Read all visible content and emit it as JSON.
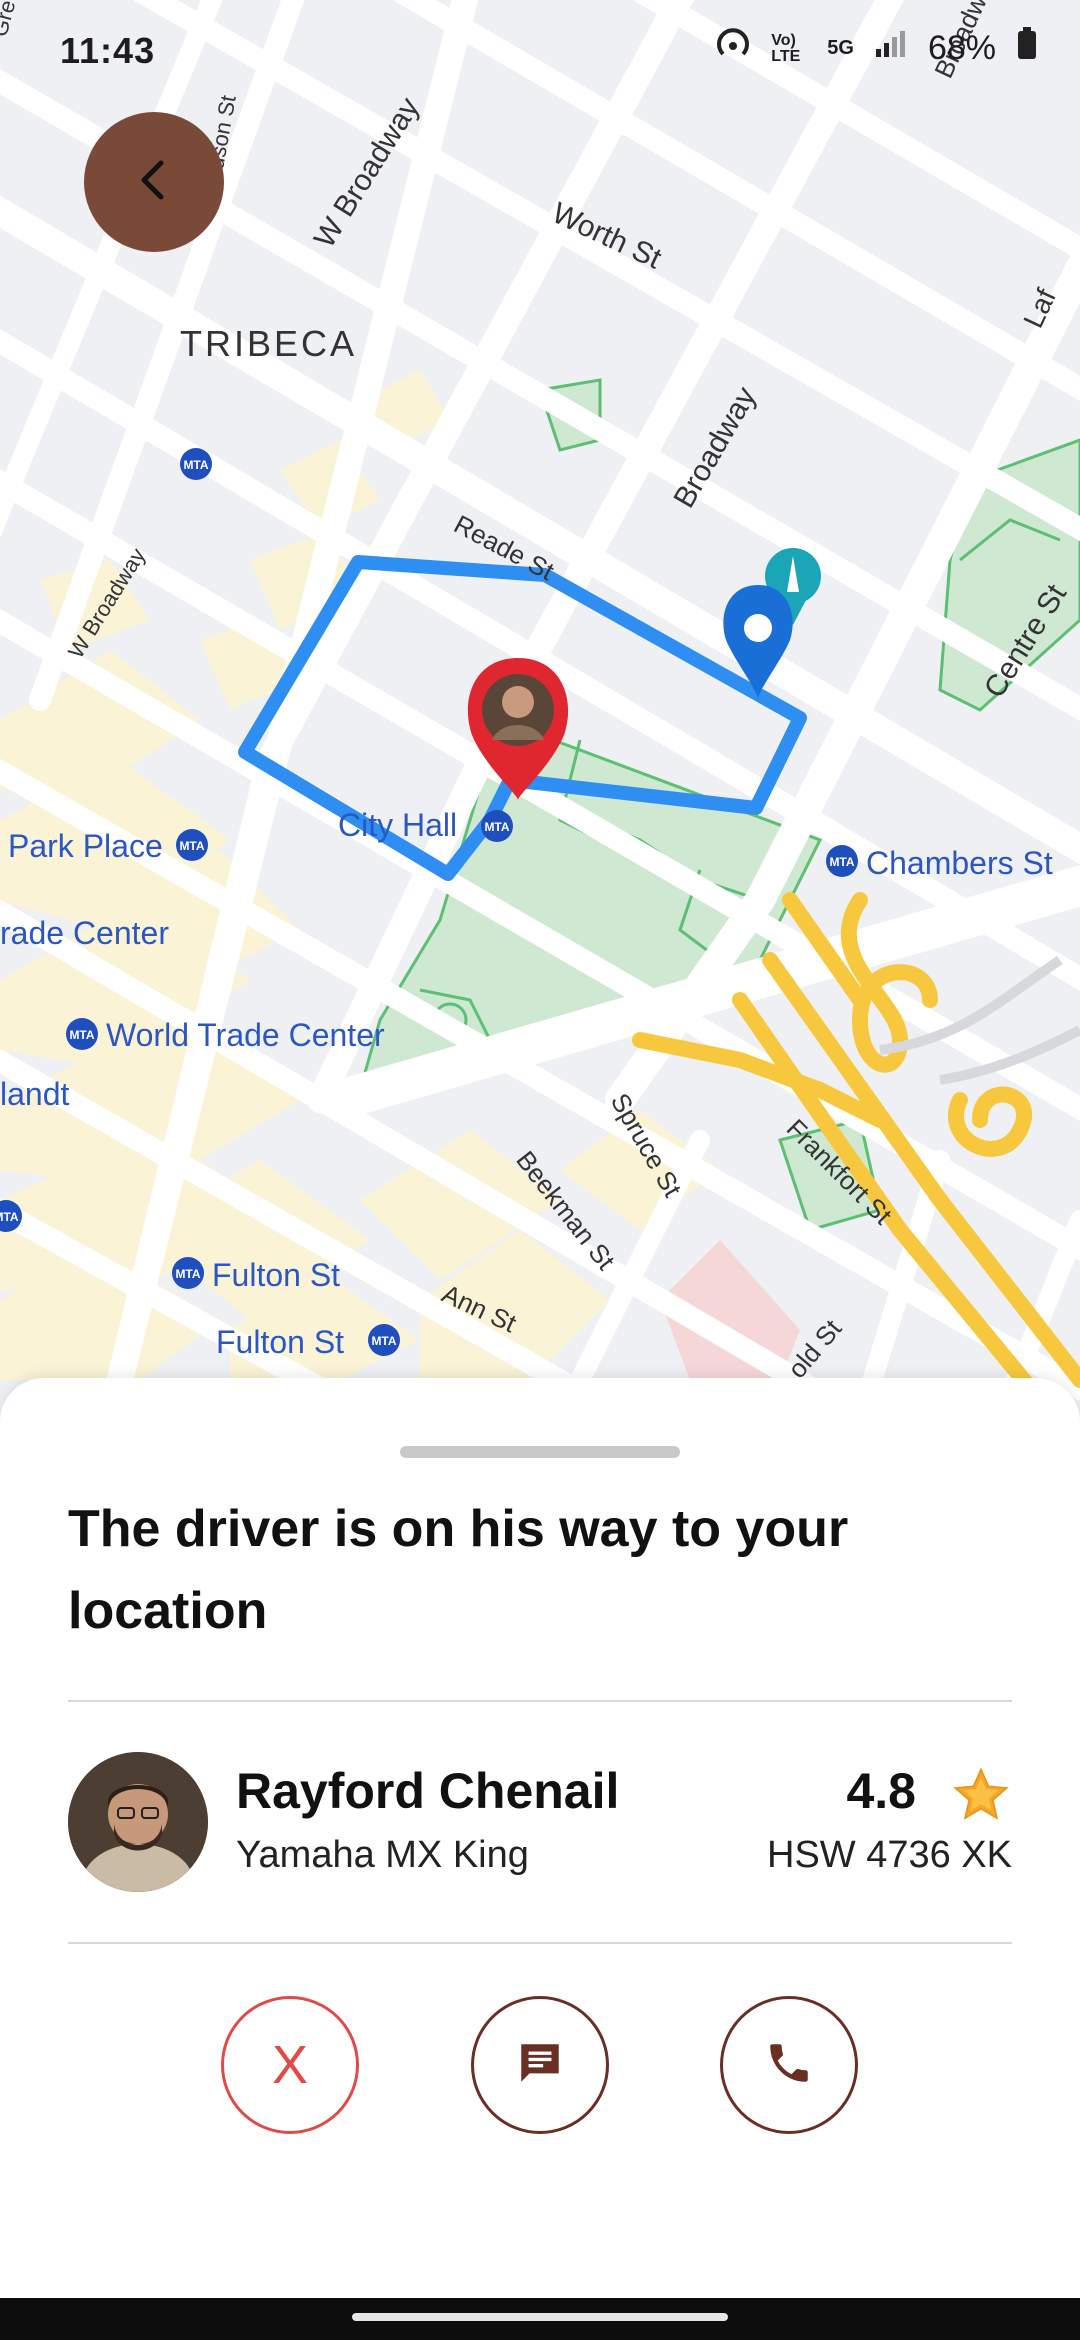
{
  "status_bar": {
    "time": "11:43",
    "network": "5G",
    "volte": "Vo) LTE",
    "battery": "68%"
  },
  "map": {
    "labels": {
      "tribeca": "TRIBECA",
      "worth_st": "Worth St",
      "w_broadway": "W Broadway",
      "w_broadway_2": "W Broadway",
      "broadway": "Broadway",
      "reade_st": "Reade St",
      "hudson_st": "Hudson St",
      "centre_st": "Centre St",
      "city_hall": "City Hall",
      "chambers_st": "Chambers St",
      "park_place": "Park Place",
      "trade_center": "rade Center",
      "world_trade_center": "World Trade Center",
      "landt": "landt",
      "fulton_st_1": "Fulton St",
      "fulton_st_2": "Fulton St",
      "spruce_st": "Spruce St",
      "beekman_st": "Beekman St",
      "frankfort_st": "Frankfort St",
      "ann_st": "Ann St",
      "gold_st": "old St",
      "lafayette": "Laf",
      "broadway_top": "Broadw",
      "greenwich": "Gre"
    },
    "metro_badge": "MTA",
    "route_color": "#2f8ef2",
    "destination_pin_color": "#1a6fd6",
    "driver_pin_color": "#e0262f"
  },
  "sheet": {
    "title": "The driver is on his way to your location",
    "driver": {
      "name": "Rayford Chenail",
      "vehicle": "Yamaha MX King",
      "rating": "4.8",
      "plate": "HSW 4736 XK"
    },
    "actions": {
      "cancel_label": "X",
      "chat_icon": "chat-bubble-icon",
      "call_icon": "phone-icon"
    }
  },
  "colors": {
    "accent_brown": "#7a4a39",
    "cancel_red": "#e04b47",
    "star": "#f6a623"
  }
}
